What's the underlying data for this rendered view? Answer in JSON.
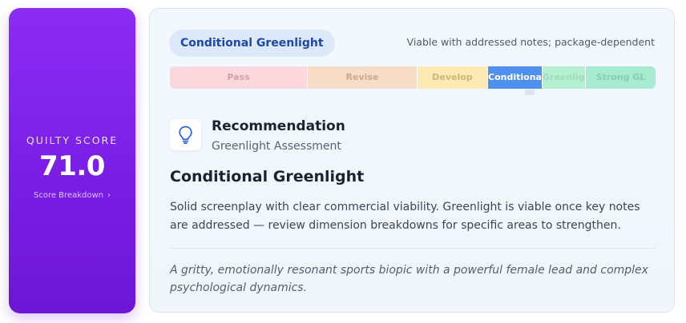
{
  "score": {
    "label": "QUILTY SCORE",
    "value": "71.0",
    "link_label": "Score Breakdown",
    "link_icon": "chevron-right-icon"
  },
  "status": {
    "pill_label": "Conditional Greenlight",
    "note": "Viable with addressed notes; package-dependent"
  },
  "scale": {
    "segments": [
      {
        "label": "Pass",
        "color": "#fbd8dd",
        "active": false
      },
      {
        "label": "Revise",
        "color": "#f7ddc8",
        "active": false
      },
      {
        "label": "Develop",
        "color": "#fbeab4",
        "active": false
      },
      {
        "label": "Conditional",
        "color": "#4f90ee",
        "active": true
      },
      {
        "label": "Greenlight",
        "color": "#b6f0d3",
        "active": false
      },
      {
        "label": "Strong GL",
        "color": "#a6ebd2",
        "active": false
      }
    ]
  },
  "recommendation": {
    "icon": "lightbulb-icon",
    "title": "Recommendation",
    "subtitle": "Greenlight Assessment",
    "verdict": "Conditional Greenlight",
    "description": "Solid screenplay with clear commercial viability. Greenlight is viable once key notes are addressed — review dimension breakdowns for specific areas to strengthen.",
    "logline": "A gritty, emotionally resonant sports biopic with a powerful female lead and complex psychological dynamics."
  },
  "colors": {
    "score_card": "#7a1ee6",
    "pill_bg": "#dce9fb",
    "pill_text": "#1f47a8",
    "active_segment": "#4f90ee"
  }
}
